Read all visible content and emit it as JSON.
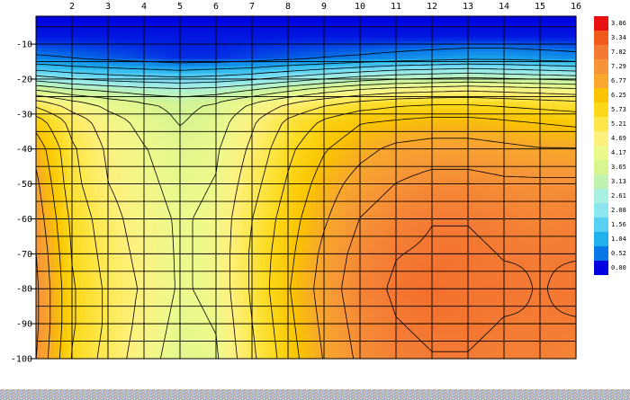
{
  "chart_data": {
    "type": "heatmap",
    "title": "",
    "xlabel": "",
    "ylabel": "",
    "x_ticks": [
      "2",
      "3",
      "4",
      "5",
      "6",
      "7",
      "8",
      "9",
      "10",
      "11",
      "12",
      "13",
      "14",
      "15",
      "16"
    ],
    "x_range": [
      1,
      16
    ],
    "y_ticks": [
      "-10",
      "-20",
      "-30",
      "-40",
      "-50",
      "-60",
      "-70",
      "-80",
      "-90",
      "-100"
    ],
    "y_range": [
      -2,
      -100
    ],
    "grid": true,
    "legend_placement": "right",
    "legend": {
      "labels": [
        "3.86",
        "3.34",
        "7.82",
        "7.29",
        "6.77",
        "6.25",
        "5.73",
        "5.21",
        "4.69",
        "4.17",
        "3.65",
        "3.13",
        "2.61",
        "2.08",
        "1.56",
        "1.04",
        "0.52",
        "0.00"
      ],
      "colors": [
        "#e81010",
        "#f05a1a",
        "#f47a34",
        "#f69437",
        "#f8a82c",
        "#fac400",
        "#fcd81a",
        "#fde74a",
        "#fef07c",
        "#eef98c",
        "#d8f590",
        "#c0f3b0",
        "#a8f0e0",
        "#8ce6f0",
        "#58d0f4",
        "#20b0ec",
        "#0878e8",
        "#0000e0"
      ]
    },
    "colormap_stops": [
      {
        "value": 0.0,
        "color": "#0000e0"
      },
      {
        "value": 0.52,
        "color": "#0878e8"
      },
      {
        "value": 1.04,
        "color": "#20b0ec"
      },
      {
        "value": 1.56,
        "color": "#58d0f4"
      },
      {
        "value": 2.08,
        "color": "#8ce6f0"
      },
      {
        "value": 2.61,
        "color": "#a8f0e0"
      },
      {
        "value": 3.13,
        "color": "#c0f3b0"
      },
      {
        "value": 3.65,
        "color": "#d8f590"
      },
      {
        "value": 4.17,
        "color": "#eef98c"
      },
      {
        "value": 4.69,
        "color": "#fef07c"
      },
      {
        "value": 5.21,
        "color": "#fde74a"
      },
      {
        "value": 5.73,
        "color": "#fcd81a"
      },
      {
        "value": 6.25,
        "color": "#fac400"
      },
      {
        "value": 6.77,
        "color": "#f8a82c"
      },
      {
        "value": 7.29,
        "color": "#f69437"
      },
      {
        "value": 7.82,
        "color": "#f47a34"
      },
      {
        "value": 8.34,
        "color": "#f05a1a"
      },
      {
        "value": 8.86,
        "color": "#e81010"
      }
    ],
    "x": [
      1,
      2,
      3,
      4,
      5,
      6,
      7,
      8,
      9,
      10,
      11,
      12,
      13,
      14,
      15,
      16
    ],
    "y": [
      -2,
      -8,
      -14,
      -17,
      -20,
      -23,
      -27,
      -32,
      -40,
      -50,
      -60,
      -70,
      -80,
      -90,
      -100
    ],
    "z": [
      [
        0.0,
        0.0,
        0.0,
        0.0,
        0.0,
        0.0,
        0.0,
        0.0,
        0.0,
        0.0,
        0.0,
        0.0,
        0.0,
        0.0,
        0.0,
        0.0
      ],
      [
        0.1,
        0.1,
        0.1,
        0.1,
        0.1,
        0.1,
        0.1,
        0.1,
        0.1,
        0.1,
        0.1,
        0.1,
        0.1,
        0.1,
        0.1,
        0.1
      ],
      [
        0.6,
        0.5,
        0.4,
        0.3,
        0.2,
        0.2,
        0.3,
        0.4,
        0.5,
        0.6,
        0.7,
        0.8,
        0.9,
        0.9,
        0.8,
        0.7
      ],
      [
        1.4,
        1.2,
        1.1,
        1.0,
        0.9,
        1.0,
        1.1,
        1.3,
        1.5,
        1.7,
        1.9,
        2.0,
        2.1,
        2.0,
        1.9,
        1.8
      ],
      [
        2.4,
        2.1,
        1.9,
        1.8,
        1.7,
        1.8,
        2.0,
        2.3,
        2.6,
        2.9,
        3.1,
        3.2,
        3.3,
        3.2,
        3.1,
        3.0
      ],
      [
        3.6,
        3.2,
        3.0,
        2.8,
        2.7,
        2.8,
        3.1,
        3.5,
        3.9,
        4.2,
        4.4,
        4.5,
        4.6,
        4.5,
        4.4,
        4.3
      ],
      [
        5.0,
        4.4,
        4.0,
        3.7,
        3.5,
        3.7,
        4.2,
        4.7,
        5.1,
        5.4,
        5.6,
        5.7,
        5.7,
        5.6,
        5.5,
        5.4
      ],
      [
        6.0,
        5.0,
        4.4,
        4.0,
        3.6,
        3.9,
        4.6,
        5.3,
        5.8,
        6.2,
        6.3,
        6.4,
        6.4,
        6.3,
        6.2,
        6.1
      ],
      [
        6.6,
        5.3,
        4.6,
        4.2,
        3.9,
        4.1,
        4.8,
        5.6,
        6.2,
        6.6,
        6.9,
        7.0,
        7.0,
        6.9,
        6.8,
        6.8
      ],
      [
        6.9,
        5.4,
        4.7,
        4.3,
        4.0,
        4.2,
        5.0,
        5.8,
        6.5,
        7.0,
        7.3,
        7.5,
        7.5,
        7.4,
        7.4,
        7.4
      ],
      [
        7.1,
        5.6,
        4.9,
        4.4,
        4.1,
        4.3,
        5.2,
        6.0,
        6.7,
        7.3,
        7.6,
        7.8,
        7.8,
        7.7,
        7.6,
        7.7
      ],
      [
        7.3,
        5.7,
        5.0,
        4.5,
        4.1,
        4.3,
        5.3,
        6.1,
        6.9,
        7.5,
        7.8,
        7.9,
        7.9,
        7.8,
        7.8,
        7.8
      ],
      [
        7.4,
        5.8,
        5.1,
        4.6,
        4.1,
        4.3,
        5.3,
        6.2,
        7.0,
        7.6,
        7.9,
        8.0,
        7.9,
        7.9,
        7.8,
        7.9
      ],
      [
        7.4,
        5.8,
        5.1,
        4.5,
        4.0,
        4.2,
        5.2,
        6.1,
        6.9,
        7.5,
        7.8,
        7.9,
        7.9,
        7.8,
        7.8,
        7.8
      ],
      [
        7.3,
        5.7,
        5.0,
        4.4,
        3.9,
        4.1,
        5.1,
        6.0,
        6.8,
        7.4,
        7.7,
        7.8,
        7.8,
        7.7,
        7.7,
        7.6
      ]
    ]
  }
}
